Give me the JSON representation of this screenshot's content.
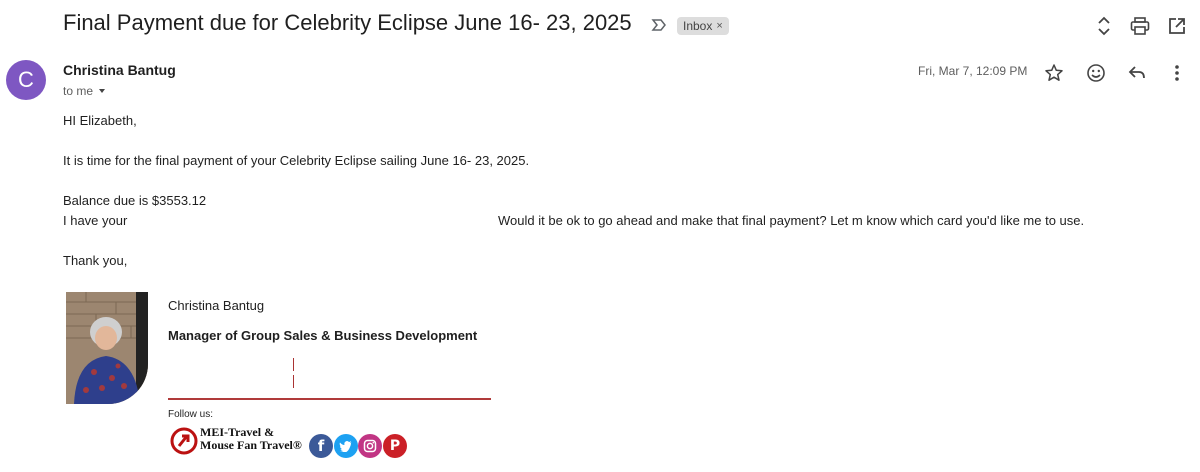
{
  "email": {
    "subject": "Final Payment due for Celebrity Eclipse June 16- 23, 2025",
    "label": "Inbox",
    "label_close": "×",
    "sender_initial": "C",
    "sender_name": "Christina Bantug",
    "to": "to me",
    "date": "Fri, Mar 7, 12:09 PM"
  },
  "body": {
    "greeting": "HI Elizabeth,",
    "line1": "It is time for the final payment of your Celebrity Eclipse sailing June 16- 23, 2025.",
    "line2": "Balance due is $3553.12",
    "line3a": "I have your",
    "line3b": "Would it be ok to go ahead and make that final payment?  Let m know which card you'd like me to use.",
    "closing": "Thank you,"
  },
  "signature": {
    "name": "Christina Bantug",
    "title": "Manager of Group Sales & Business Development",
    "follow": "Follow us:",
    "brand_line1": "MEI-Travel  &",
    "brand_line2": "Mouse Fan Travel®"
  },
  "icons": {
    "important": "label-importance-icon",
    "updown": "expand-collapse-icon",
    "print": "print-icon",
    "newwindow": "open-in-new-window-icon",
    "star": "star-icon",
    "emoji": "emoji-icon",
    "reply": "reply-icon",
    "more": "more-vert-icon"
  },
  "colors": {
    "avatar": "#7e57c2",
    "facebook": "#3b5998",
    "twitter": "#1da1f2",
    "instagram": "#c13584",
    "pinterest": "#cb2027",
    "signature_rule": "#b03a3a"
  }
}
